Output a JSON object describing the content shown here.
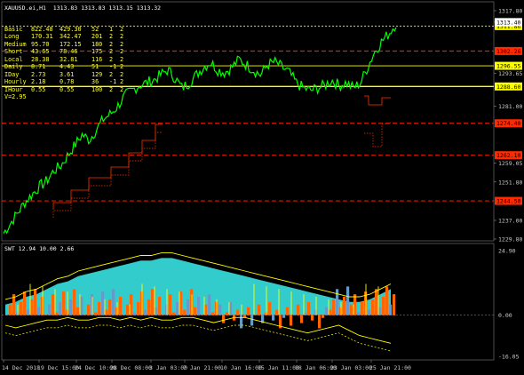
{
  "colors": {
    "background": "#000000",
    "price_line": "#00ff00",
    "level_yellow": "#ffff00",
    "level_red": "#ff2a00",
    "stair_red": "#ff3300",
    "indicator_cyan": "#33cccc",
    "indicator_orange": "#ff6600",
    "indicator_blue": "#6699cc",
    "indicator_yellow": "#ffff00",
    "axis_label_bg_red": "#ff2a00",
    "axis_label_bg_yellow": "#ffff00"
  },
  "header": {
    "main_title": "XAUUSD.ei,H1  1313.83 1313.83 1313.15 1313.32",
    "sub_title": "SWT 12.94 10.00 2.66"
  },
  "stats_table": {
    "rows": [
      [
        "Basic",
        "822.48",
        "429.30",
        "52",
        "1",
        "2"
      ],
      [
        "Long",
        "170.31",
        "342.47",
        "201",
        "2",
        "2"
      ],
      [
        "Medium",
        "95.70",
        "172.15",
        "180",
        "2",
        "2"
      ],
      [
        "Short",
        "43.65",
        "78.46",
        "175",
        "2",
        "2"
      ],
      [
        "Local",
        "28.38",
        "32.81",
        "116",
        "2",
        "2"
      ],
      [
        "Daily",
        "8.71",
        "4.43",
        "51",
        "-1",
        "2"
      ],
      [
        "IDay",
        "2.73",
        "3.61",
        "129",
        "2",
        "2"
      ],
      [
        "Hourly",
        "2.18",
        "0.78",
        "36",
        "-1",
        "2"
      ],
      [
        "IHour",
        "0.55",
        "0.55",
        "100",
        "2",
        "2"
      ]
    ],
    "footer": "V=2.95"
  },
  "chart_data": [
    {
      "type": "line",
      "title": "XAUUSD.ei,H1",
      "y_ticks": [
        "1317.80",
        "1313.40",
        "1293.65",
        "1281.00",
        "1259.05",
        "1251.80",
        "1237.00",
        "1229.80"
      ],
      "level_labels": [
        {
          "value": "1311.86",
          "style": "yellow"
        },
        {
          "value": "1302.26",
          "style": "red"
        },
        {
          "value": "1296.55",
          "style": "yellow"
        },
        {
          "value": "1288.60",
          "style": "yellow"
        },
        {
          "value": "1274.40",
          "style": "red"
        },
        {
          "value": "1262.10",
          "style": "red"
        },
        {
          "value": "1244.50",
          "style": "red"
        }
      ],
      "series": [
        {
          "values": [
            1232,
            1236,
            1240,
            1244,
            1247,
            1250,
            1252,
            1256,
            1258,
            1262,
            1266,
            1270,
            1268,
            1272,
            1276,
            1278,
            1281,
            1285,
            1287,
            1289,
            1290,
            1291,
            1293,
            1295,
            1292,
            1288,
            1290,
            1293,
            1296,
            1298,
            1295,
            1294,
            1296,
            1299,
            1297,
            1295,
            1293,
            1297,
            1298,
            1296,
            1294,
            1290,
            1288,
            1287,
            1288,
            1289,
            1291,
            1289,
            1290,
            1288,
            1290,
            1296,
            1302,
            1306,
            1309,
            1313
          ]
        }
      ]
    },
    {
      "type": "area",
      "title": "SWT",
      "y_ticks": [
        "24.90",
        "0.00",
        "-16.05"
      ],
      "x_ticks": [
        "14 Dec 2018",
        "19 Dec 15:00",
        "24 Dec 10:00",
        "28 Dec 08:00",
        "3 Jan 03:00",
        "7 Jan 21:00",
        "10 Jan 16:00",
        "15 Jan 11:00",
        "18 Jan 06:00",
        "23 Jan 03:00",
        "25 Jan 21:00"
      ],
      "series": [
        {
          "name": "upper",
          "values": [
            4,
            5,
            7,
            8,
            10,
            12,
            13,
            15,
            16,
            17,
            18,
            19,
            20,
            21,
            21,
            22,
            22,
            21,
            20,
            19,
            18,
            17,
            16,
            15,
            14,
            13,
            12,
            11,
            10,
            9,
            8,
            7,
            6,
            5,
            5,
            6,
            8,
            10
          ]
        },
        {
          "name": "lower",
          "values": [
            -4,
            -5,
            -4,
            -3,
            -2,
            -2,
            -1,
            -2,
            -2,
            -1,
            -1,
            -2,
            -1,
            -2,
            -1,
            -2,
            -2,
            -1,
            -1,
            -2,
            -3,
            -2,
            -1,
            -1,
            -2,
            -3,
            -4,
            -5,
            -6,
            -7,
            -6,
            -5,
            -4,
            -6,
            -8,
            -9,
            -10,
            -11
          ]
        }
      ]
    }
  ]
}
